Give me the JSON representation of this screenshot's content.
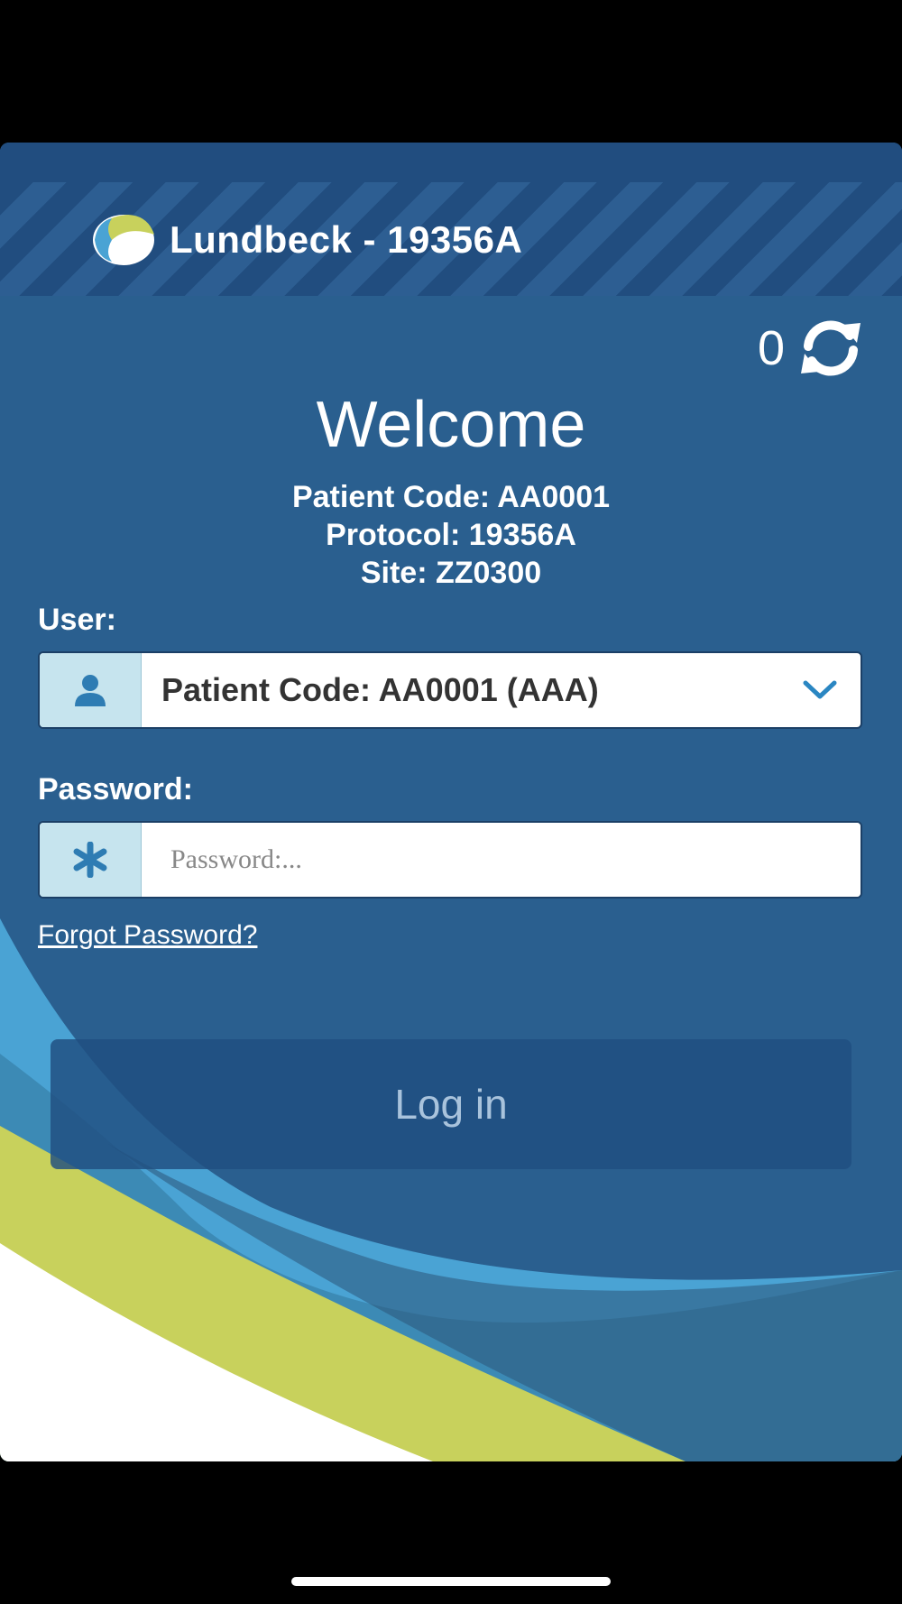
{
  "header": {
    "title": "Lundbeck - 19356A",
    "logo_icon": "lundbeck-logo-icon"
  },
  "sync": {
    "count": "0",
    "icon": "refresh-icon"
  },
  "welcome": {
    "heading": "Welcome",
    "patient_code": "Patient Code: AA0001",
    "protocol": "Protocol: 19356A",
    "site": "Site: ZZ0300"
  },
  "user_field": {
    "label": "User:",
    "icon": "user-icon",
    "selected_value": "Patient Code: AA0001 (AAA)",
    "chevron_icon": "chevron-down-icon"
  },
  "password_field": {
    "label": "Password:",
    "icon": "asterisk-icon",
    "placeholder": "Password:...",
    "value": ""
  },
  "links": {
    "forgot_password": "Forgot Password?"
  },
  "actions": {
    "login_label": "Log in"
  },
  "colors": {
    "background_blue": "#2a5f8f",
    "header_blue": "#214d7f",
    "light_blue": "#4aa3d4",
    "lime_green": "#c8d15c",
    "addon_bg": "#c6e4ee",
    "chevron_blue": "#2a86c2"
  }
}
